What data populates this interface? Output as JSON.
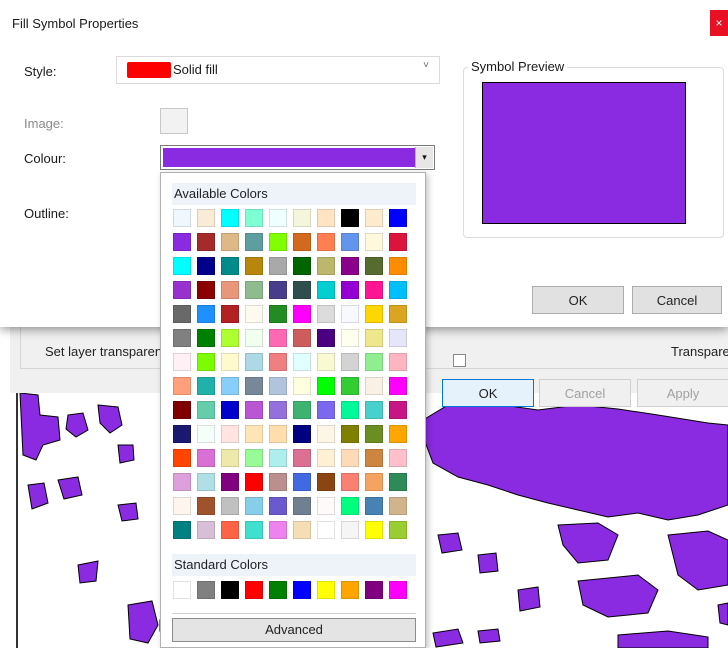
{
  "title": "Fill Symbol Properties",
  "close_glyph": "×",
  "style": {
    "label": "Style:",
    "value": "Solid fill",
    "swatch_color": "#ff0000",
    "chevron": "˅"
  },
  "image": {
    "label": "Image:"
  },
  "colour": {
    "label": "Colour:",
    "value_color": "#8a2be2",
    "arrow": "▾"
  },
  "outline": {
    "label": "Outline:"
  },
  "preview": {
    "label": "Symbol Preview",
    "color": "#8a2be2"
  },
  "buttons": {
    "ok": "OK",
    "cancel": "Cancel"
  },
  "background_dialog": {
    "transparency_label": "Set layer transparency",
    "transparency_right": "Transparent",
    "ok": "OK",
    "cancel": "Cancel",
    "apply": "Apply"
  },
  "picker": {
    "available_heading": "Available Colors",
    "standard_heading": "Standard Colors",
    "advanced": "Advanced",
    "available_colors": [
      "#f0f8ff",
      "#faebd7",
      "#00ffff",
      "#7fffd4",
      "#f0ffff",
      "#f5f5dc",
      "#ffe4c4",
      "#000000",
      "#ffebcd",
      "#0000ff",
      "#8a2be2",
      "#a52a2a",
      "#deb887",
      "#5f9ea0",
      "#7fff00",
      "#d2691e",
      "#ff7f50",
      "#6495ed",
      "#fff8dc",
      "#dc143c",
      "#00ffff",
      "#00008b",
      "#008b8b",
      "#b8860b",
      "#a9a9a9",
      "#006400",
      "#bdb76b",
      "#8b008b",
      "#556b2f",
      "#ff8c00",
      "#9932cc",
      "#8b0000",
      "#e9967a",
      "#8fbc8f",
      "#483d8b",
      "#2f4f4f",
      "#00ced1",
      "#9400d3",
      "#ff1493",
      "#00bfff",
      "#696969",
      "#1e90ff",
      "#b22222",
      "#fffaf0",
      "#228b22",
      "#ff00ff",
      "#dcdcdc",
      "#f8f8ff",
      "#ffd700",
      "#daa520",
      "#808080",
      "#008000",
      "#adff2f",
      "#f0fff0",
      "#ff69b4",
      "#cd5c5c",
      "#4b0082",
      "#fffff0",
      "#f0e68c",
      "#e6e6fa",
      "#fff0f5",
      "#7cfc00",
      "#fffacd",
      "#add8e6",
      "#f08080",
      "#e0ffff",
      "#fafad2",
      "#d3d3d3",
      "#90ee90",
      "#ffb6c1",
      "#ffa07a",
      "#20b2aa",
      "#87cefa",
      "#778899",
      "#b0c4de",
      "#ffffe0",
      "#00ff00",
      "#32cd32",
      "#faf0e6",
      "#ff00ff",
      "#800000",
      "#66cdaa",
      "#0000cd",
      "#ba55d3",
      "#9370db",
      "#3cb371",
      "#7b68ee",
      "#00fa9a",
      "#48d1cc",
      "#c71585",
      "#191970",
      "#f5fffa",
      "#ffe4e1",
      "#ffe4b5",
      "#ffdead",
      "#000080",
      "#fdf5e6",
      "#808000",
      "#6b8e23",
      "#ffa500",
      "#ff4500",
      "#da70d6",
      "#eee8aa",
      "#98fb98",
      "#afeeee",
      "#db7093",
      "#ffefd5",
      "#ffdab9",
      "#cd853f",
      "#ffc0cb",
      "#dda0dd",
      "#b0e0e6",
      "#800080",
      "#ff0000",
      "#bc8f8f",
      "#4169e1",
      "#8b4513",
      "#fa8072",
      "#f4a460",
      "#2e8b57",
      "#fff5ee",
      "#a0522d",
      "#c0c0c0",
      "#87ceeb",
      "#6a5acd",
      "#708090",
      "#fffafa",
      "#00ff7f",
      "#4682b4",
      "#d2b48c",
      "#008080",
      "#d8bfd8",
      "#ff6347",
      "#40e0d0",
      "#ee82ee",
      "#f5deb3",
      "#ffffff",
      "#f5f5f5",
      "#ffff00",
      "#9acd32"
    ],
    "standard_colors": [
      "#ffffff",
      "#808080",
      "#000000",
      "#ff0000",
      "#008000",
      "#0000ff",
      "#ffff00",
      "#ffa500",
      "#800080",
      "#ff00ff"
    ]
  },
  "map": {
    "fill_color": "#8a2be2",
    "stroke_color": "#000000"
  }
}
